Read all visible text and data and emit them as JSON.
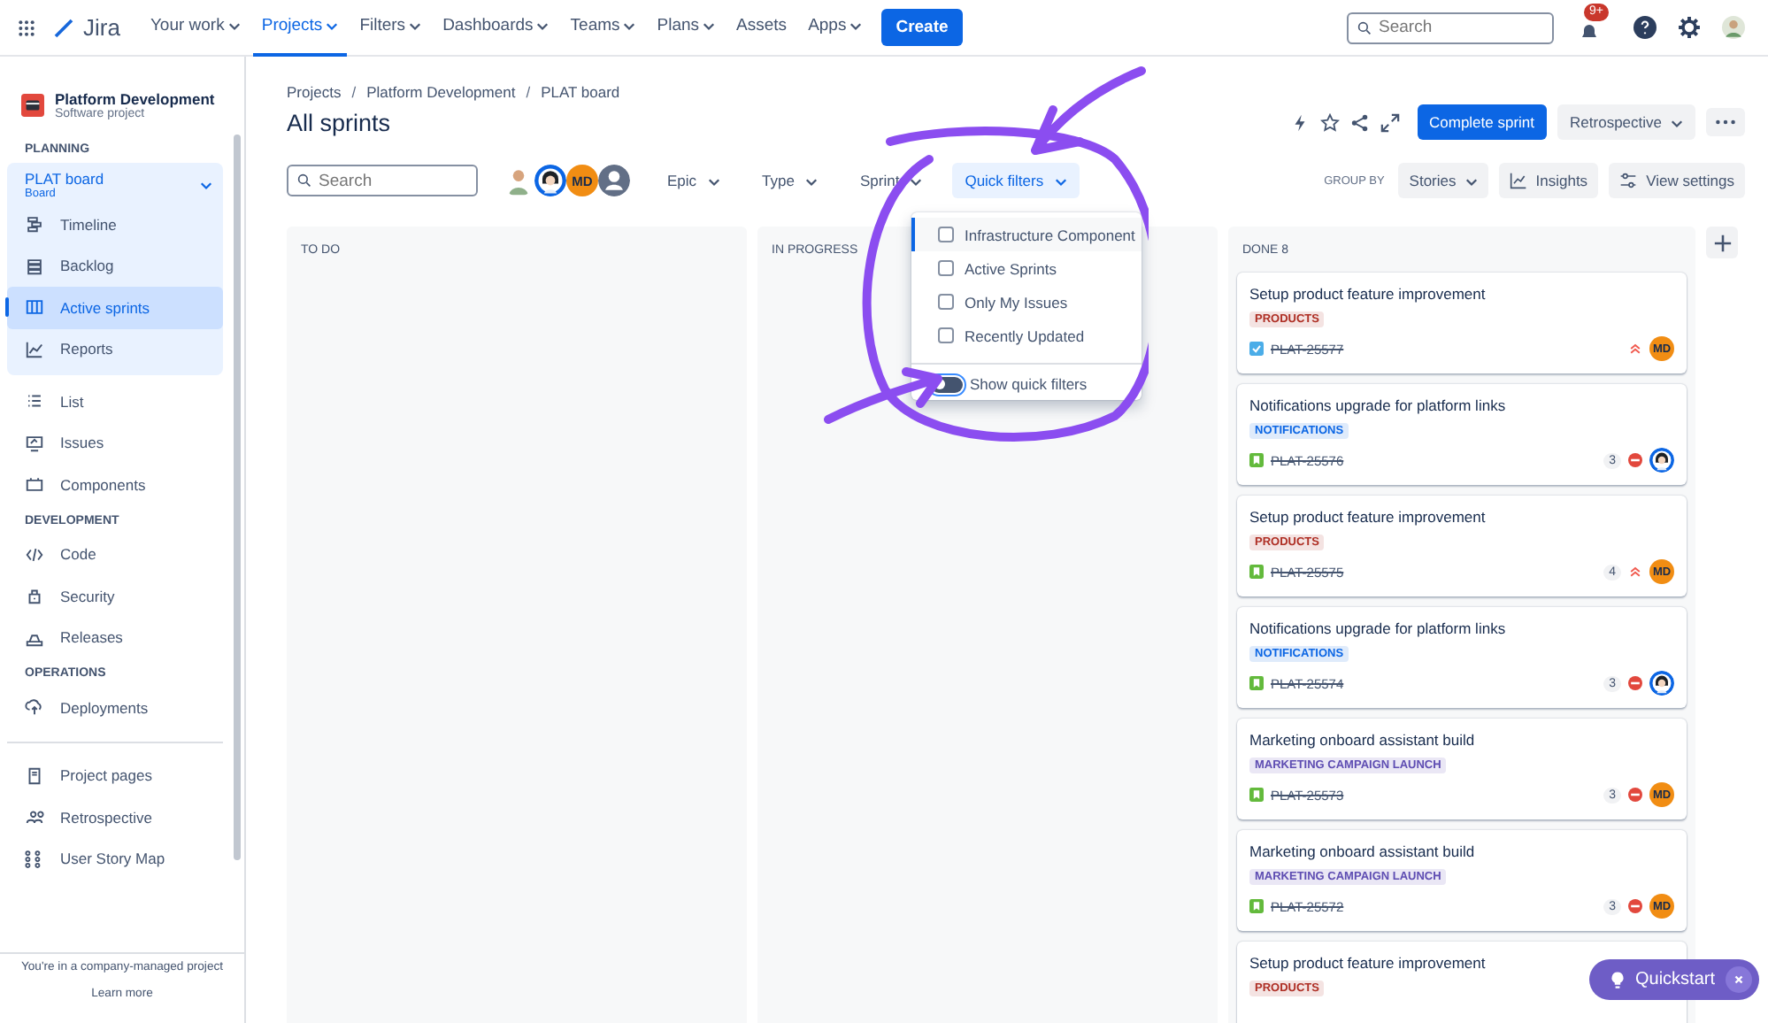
{
  "topnav": {
    "logo": "Jira",
    "menu": [
      {
        "label": "Your work",
        "selected": false,
        "dropdown": true
      },
      {
        "label": "Projects",
        "selected": true,
        "dropdown": true
      },
      {
        "label": "Filters",
        "selected": false,
        "dropdown": true
      },
      {
        "label": "Dashboards",
        "selected": false,
        "dropdown": true
      },
      {
        "label": "Teams",
        "selected": false,
        "dropdown": true
      },
      {
        "label": "Plans",
        "selected": false,
        "dropdown": true
      },
      {
        "label": "Assets",
        "selected": false,
        "dropdown": false
      },
      {
        "label": "Apps",
        "selected": false,
        "dropdown": true
      }
    ],
    "create": "Create",
    "search": {
      "placeholder": "Search"
    },
    "notifications_badge": "9+"
  },
  "sidebar": {
    "project": {
      "name": "Platform Development",
      "type": "Software project"
    },
    "groups": [
      {
        "heading": "PLANNING",
        "items": [
          {
            "label": "PLAT board",
            "sublabel": "Board",
            "kind": "board-group",
            "expanded": true,
            "children": [
              {
                "label": "Timeline",
                "kind": "timeline",
                "selected": false
              },
              {
                "label": "Backlog",
                "kind": "backlog",
                "selected": false
              },
              {
                "label": "Active sprints",
                "kind": "columns",
                "selected": true
              },
              {
                "label": "Reports",
                "kind": "reports",
                "selected": false
              }
            ]
          },
          {
            "label": "List",
            "kind": "list",
            "selected": false
          },
          {
            "label": "Issues",
            "kind": "issues",
            "selected": false
          },
          {
            "label": "Components",
            "kind": "components",
            "selected": false
          }
        ]
      },
      {
        "heading": "DEVELOPMENT",
        "items": [
          {
            "label": "Code",
            "kind": "code",
            "selected": false
          },
          {
            "label": "Security",
            "kind": "security",
            "selected": false
          },
          {
            "label": "Releases",
            "kind": "releases",
            "selected": false
          }
        ]
      },
      {
        "heading": "OPERATIONS",
        "items": [
          {
            "label": "Deployments",
            "kind": "deployments",
            "selected": false
          }
        ]
      },
      {
        "divider": true,
        "items": [
          {
            "label": "Project pages",
            "kind": "pages",
            "selected": false
          },
          {
            "label": "Retrospective",
            "kind": "retro",
            "selected": false
          },
          {
            "label": "User Story Map",
            "kind": "storymap",
            "selected": false
          }
        ]
      }
    ],
    "footer": {
      "text": "You're in a company-managed project",
      "link": "Learn more"
    }
  },
  "breadcrumbs": [
    {
      "label": "Projects"
    },
    {
      "separator": "/",
      "label": "Platform Development"
    },
    {
      "separator": "/",
      "label": "PLAT board"
    }
  ],
  "title": "All sprints",
  "actions": {
    "complete": "Complete sprint",
    "retrospective": "Retrospective"
  },
  "toolbar": {
    "search": {
      "placeholder": "Search"
    },
    "avatars": [
      {
        "kind": "photo"
      },
      {
        "kind": "figure"
      },
      {
        "kind": "initials",
        "initials": "MD"
      },
      {
        "kind": "blank"
      }
    ],
    "filters": [
      {
        "label": "Epic",
        "selected": false
      },
      {
        "label": "Type",
        "selected": false
      },
      {
        "label": "Sprint",
        "selected": false
      },
      {
        "label": "Quick filters",
        "selected": true
      }
    ],
    "group_by": "GROUP BY",
    "stories": "Stories",
    "insights": "Insights",
    "view_settings": "View settings"
  },
  "quick_filters": {
    "options": [
      {
        "label": "Infrastructure Component",
        "checked": false,
        "focused": true
      },
      {
        "label": "Active Sprints",
        "checked": false,
        "focused": false
      },
      {
        "label": "Only My Issues",
        "checked": false,
        "focused": false
      },
      {
        "label": "Recently Updated",
        "checked": false,
        "focused": false
      }
    ],
    "toggle": {
      "label": "Show quick filters",
      "on": false
    }
  },
  "columns": [
    {
      "title": "TO DO"
    },
    {
      "title": "IN PROGRESS"
    },
    {
      "title": "DONE 8",
      "cards": [
        {
          "title": "Setup product feature improvement",
          "tag": {
            "label": "PRODUCTS",
            "color": "#ae2e24"
          },
          "issue_type": {
            "kind": "task"
          },
          "key": "PLAT-25577",
          "priority": {
            "kind": "highest"
          },
          "assignee": {
            "kind": "initials",
            "initials": "MD"
          }
        },
        {
          "title": "Notifications upgrade for platform links",
          "tag": {
            "label": "NOTIFICATIONS",
            "color": "#0c66e4"
          },
          "issue_type": {
            "kind": "story"
          },
          "key": "PLAT-25576",
          "count": "3",
          "priority": {
            "kind": "blocker"
          },
          "assignee": {
            "kind": "figure"
          }
        },
        {
          "title": "Setup product feature improvement",
          "tag": {
            "label": "PRODUCTS",
            "color": "#ae2e24"
          },
          "issue_type": {
            "kind": "story"
          },
          "key": "PLAT-25575",
          "count": "4",
          "priority": {
            "kind": "highest"
          },
          "assignee": {
            "kind": "initials",
            "initials": "MD"
          }
        },
        {
          "title": "Notifications upgrade for platform links",
          "tag": {
            "label": "NOTIFICATIONS",
            "color": "#0c66e4"
          },
          "issue_type": {
            "kind": "story"
          },
          "key": "PLAT-25574",
          "count": "3",
          "priority": {
            "kind": "blocker"
          },
          "assignee": {
            "kind": "figure"
          }
        },
        {
          "title": "Marketing onboard assistant build",
          "tag": {
            "label": "MARKETING CAMPAIGN LAUNCH",
            "color": "#5e4db2"
          },
          "issue_type": {
            "kind": "story"
          },
          "key": "PLAT-25573",
          "count": "3",
          "priority": {
            "kind": "blocker"
          },
          "assignee": {
            "kind": "initials",
            "initials": "MD"
          }
        },
        {
          "title": "Marketing onboard assistant build",
          "tag": {
            "label": "MARKETING CAMPAIGN LAUNCH",
            "color": "#5e4db2"
          },
          "issue_type": {
            "kind": "story"
          },
          "key": "PLAT-25572",
          "count": "3",
          "priority": {
            "kind": "blocker"
          },
          "assignee": {
            "kind": "initials",
            "initials": "MD"
          }
        },
        {
          "title": "Setup product feature improvement",
          "tag": {
            "label": "PRODUCTS",
            "color": "#ae2e24"
          }
        }
      ]
    }
  ],
  "quickstart": "Quickstart"
}
